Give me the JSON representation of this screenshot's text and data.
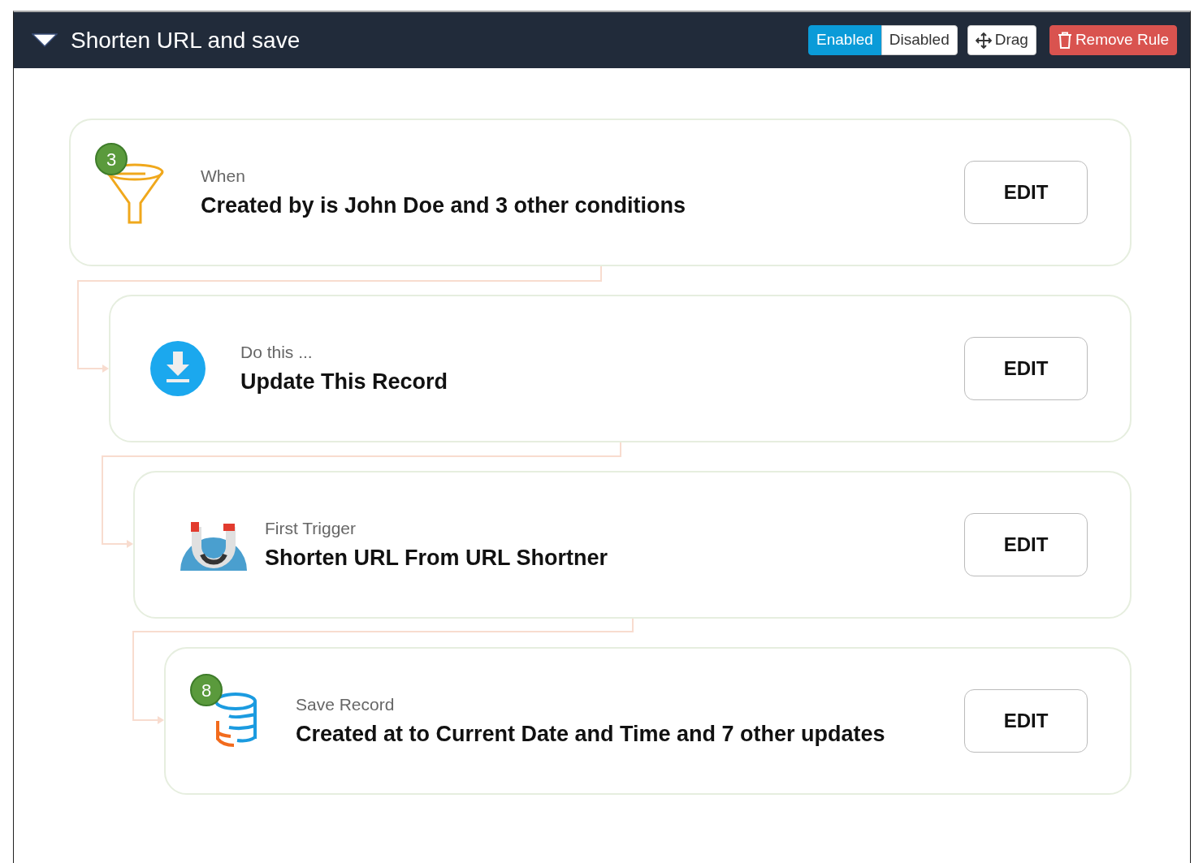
{
  "rule": {
    "title": "Shorten URL and save",
    "expanded": true
  },
  "status_toggle": [
    {
      "label": "Enabled",
      "selected": true
    },
    {
      "label": "Disabled",
      "selected": false
    }
  ],
  "buttons": [
    {
      "kind": "drag",
      "label": "Drag"
    },
    {
      "kind": "remove",
      "label": "Remove Rule"
    }
  ],
  "steps": [
    {
      "kind": "filter",
      "label": "When",
      "title": "Created by is John Doe and 3 other conditions",
      "badge": "3",
      "button": "EDIT"
    },
    {
      "kind": "update",
      "label": "Do this ...",
      "title": "Update This Record",
      "button": "EDIT"
    },
    {
      "kind": "trigger",
      "label": "First Trigger",
      "title": "Shorten URL From URL Shortner",
      "button": "EDIT"
    },
    {
      "kind": "save",
      "label": "Save Record",
      "title": "Created at to Current Date and Time and 7 other updates",
      "badge": "8",
      "button": "EDIT"
    }
  ]
}
